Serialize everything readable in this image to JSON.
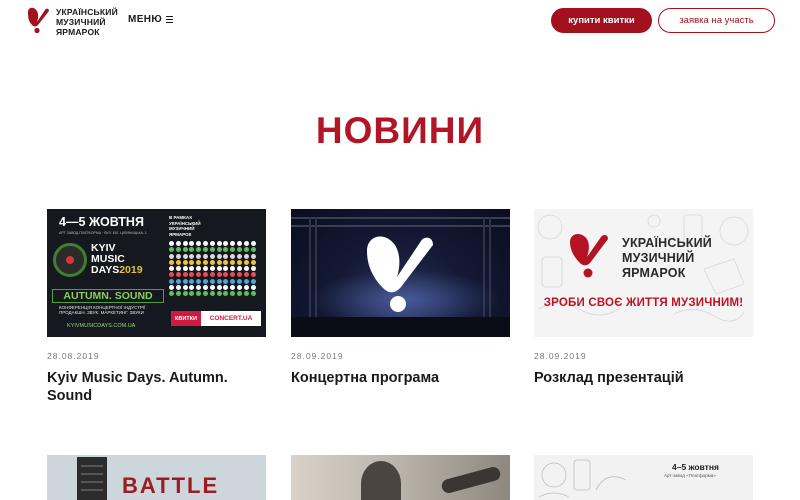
{
  "header": {
    "logo_lines": [
      "УКРАЇНСЬКИЙ",
      "МУЗИЧНИЙ",
      "ЯРМАРОК"
    ],
    "menu_label": "МЕНЮ",
    "buy_label": "купити квитки",
    "apply_label": "заявка на участь"
  },
  "page": {
    "title": "НОВИНИ"
  },
  "news": [
    {
      "date": "28.08.2019",
      "title": "Kyiv Music Days. Autumn. Sound",
      "thumb": {
        "dates": "4—5 ЖОВТНЯ",
        "venue": "АРТ ЗАВОД ПЛАТФОРМА · ВУЛ. БІЛ. ЦІЛИНИЦЬКА, 1",
        "name_line1": "KYIV",
        "name_line2": "MUSIC",
        "name_line3": "DAYS",
        "year": "2019",
        "autumn": "AUTUMN. SOUND",
        "conference": "КОНФЕРЕНЦІЯ КОНЦЕРТНОЇ ІНДУСТРІЇ ПРОДАКШН. ЗВУК. МАРКЕТИНГ. ЗВУКИ",
        "site": "KYIVMUSICDAYS.COM.UA",
        "in_frame": "В РАМКАХ",
        "umf_lines": [
          "УКРАЇНСЬКИЙ",
          "МУЗИЧНИЙ",
          "ЯРМАРОК"
        ],
        "tickets": "КВИТКИ",
        "concert": "CONCERT.UA"
      }
    },
    {
      "date": "28.09.2019",
      "title": "Концертна програма"
    },
    {
      "date": "28.09.2019",
      "title": "Розклад презентацій",
      "thumb": {
        "mark_lines": [
          "УКРАЇНСЬКИЙ",
          "МУЗИЧНИЙ",
          "ЯРМАРОК"
        ],
        "slogan": "ЗРОБИ СВОЄ ЖИТТЯ МУЗИЧНИМ!"
      }
    }
  ],
  "more_news": [
    {
      "thumb_text": "BATTLE"
    },
    {
      "thumb_text": ""
    },
    {
      "thumb_dates": "4–5 жовтня",
      "thumb_place": "Арт-завод «Платформа»"
    }
  ],
  "colors": {
    "brand": "#a3111e",
    "title": "#b21626"
  },
  "icons": {
    "logo": "umf-heart-logo-icon",
    "menu": "hamburger-icon"
  }
}
